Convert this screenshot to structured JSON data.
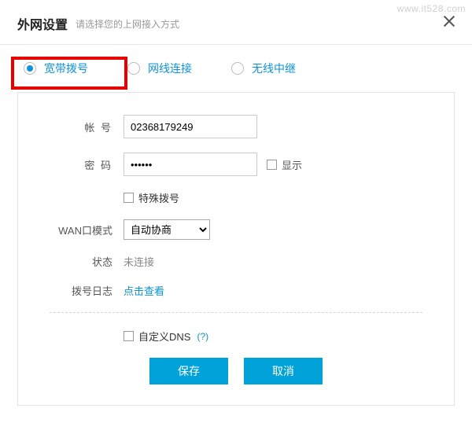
{
  "watermark": "www.it528.com",
  "header": {
    "title": "外网设置",
    "hint": "请选择您的上网接入方式"
  },
  "tabs": {
    "broadband": "宽带拨号",
    "lan": "网线连接",
    "relay": "无线中继",
    "selected": "broadband"
  },
  "form": {
    "account_label": "帐 号",
    "account_value": "02368179249",
    "password_label": "密 码",
    "password_value": "••••••",
    "show_pw_label": "显示",
    "special_dial_label": "特殊拨号",
    "wan_mode_label": "WAN口模式",
    "wan_mode_value": "自动协商",
    "status_label": "状态",
    "status_value": "未连接",
    "dial_log_label": "拨号日志",
    "dial_log_link": "点击查看",
    "custom_dns_label": "自定义DNS",
    "custom_dns_help": "(?)"
  },
  "buttons": {
    "save": "保存",
    "cancel": "取消"
  }
}
